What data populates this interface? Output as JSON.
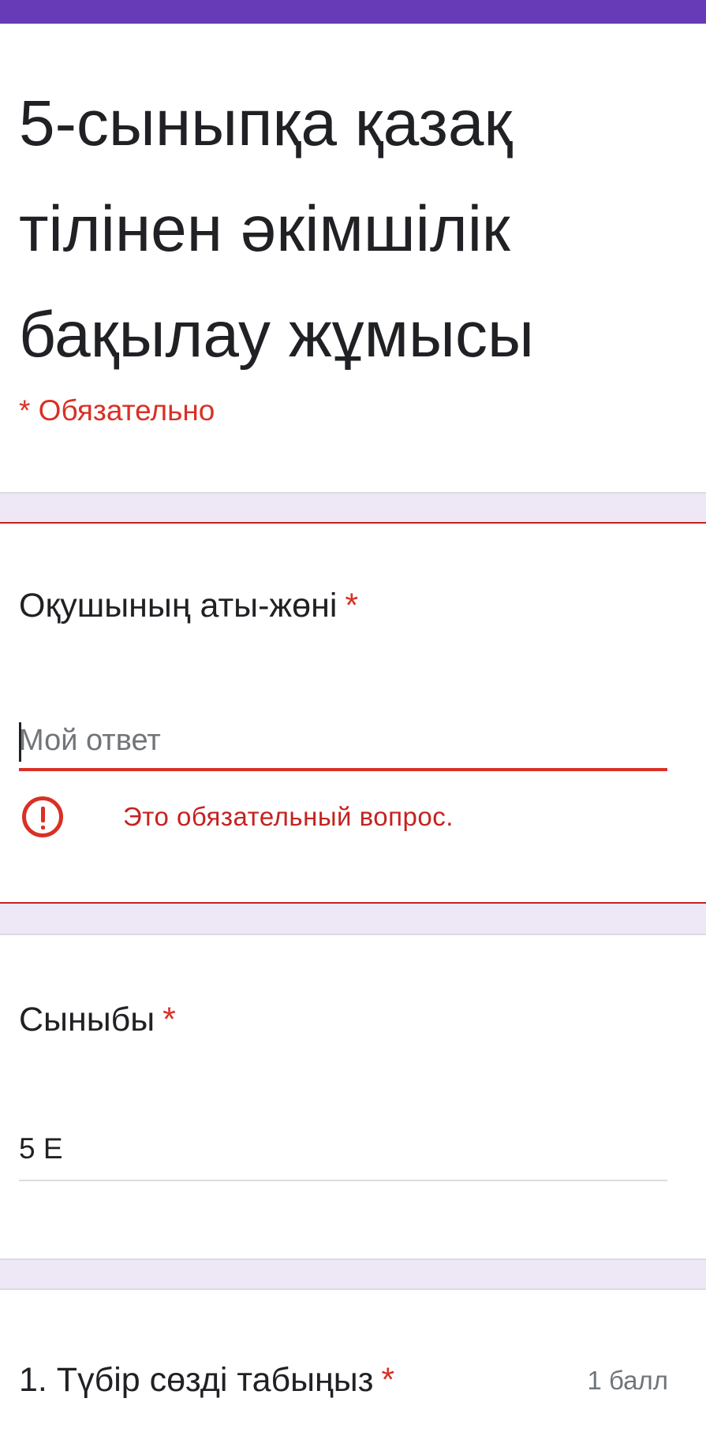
{
  "form": {
    "title": "5-сыныпқа қазақ тілінен әкімшілік бақылау жұмысы",
    "required_note": "* Обязательно"
  },
  "questions": {
    "name": {
      "label": "Оқушының аты-жөні",
      "star": "*",
      "placeholder": "Мой ответ",
      "value": "",
      "error": "Это обязательный вопрос."
    },
    "class": {
      "label": "Сыныбы",
      "star": "*",
      "value": "5 Е"
    },
    "q1": {
      "label": "1. Түбір сөзді табыңыз",
      "star": "*",
      "points": "1 балл"
    }
  },
  "colors": {
    "accent": "#673ab7",
    "error": "#d93025",
    "background": "#ede7f6"
  }
}
